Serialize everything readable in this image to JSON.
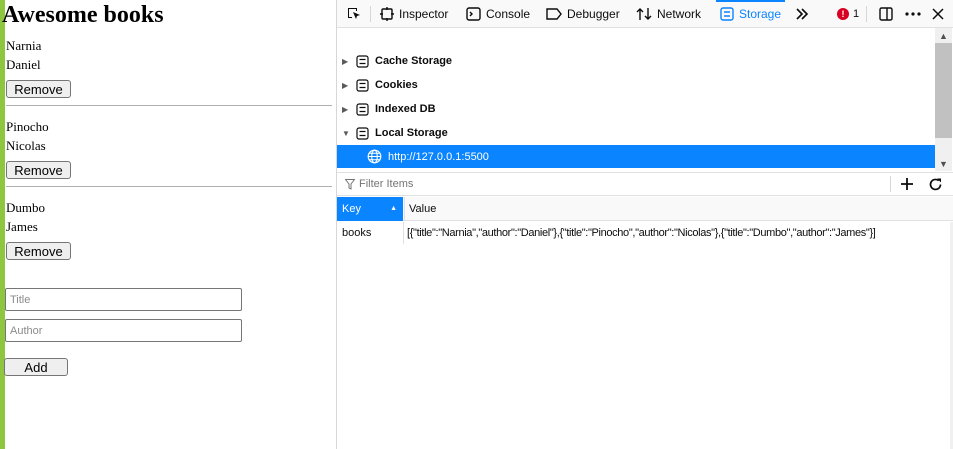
{
  "page": {
    "title": "Awesome books",
    "books": [
      {
        "title": "Narnia",
        "author": "Daniel",
        "remove_label": "Remove"
      },
      {
        "title": "Pinocho",
        "author": "Nicolas",
        "remove_label": "Remove"
      },
      {
        "title": "Dumbo",
        "author": "James",
        "remove_label": "Remove"
      }
    ],
    "form": {
      "title_placeholder": "Title",
      "author_placeholder": "Author",
      "add_label": "Add"
    },
    "accent_color": "#8ec63f"
  },
  "devtools": {
    "tabs": [
      {
        "label": "Inspector",
        "icon": "inspector-icon"
      },
      {
        "label": "Console",
        "icon": "console-icon"
      },
      {
        "label": "Debugger",
        "icon": "debugger-icon"
      },
      {
        "label": "Network",
        "icon": "network-icon"
      },
      {
        "label": "Storage",
        "icon": "storage-icon",
        "active": true
      }
    ],
    "error_count": "1",
    "tree": {
      "items": [
        {
          "label": "Cache Storage",
          "expanded": false
        },
        {
          "label": "Cookies",
          "expanded": false
        },
        {
          "label": "Indexed DB",
          "expanded": false
        },
        {
          "label": "Local Storage",
          "expanded": true
        }
      ],
      "selected_child": "http://127.0.0.1:5500"
    },
    "filter": {
      "placeholder": "Filter Items"
    },
    "table": {
      "columns": [
        "Key",
        "Value"
      ],
      "rows": [
        {
          "key": "books",
          "value": "[{\"title\":\"Narnia\",\"author\":\"Daniel\"},{\"title\":\"Pinocho\",\"author\":\"Nicolas\"},{\"title\":\"Dumbo\",\"author\":\"James\"}]"
        }
      ]
    },
    "accent_color": "#0a84ff",
    "error_color": "#d70022"
  }
}
